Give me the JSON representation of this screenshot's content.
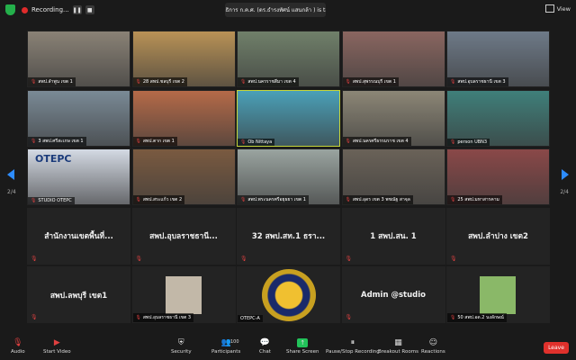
{
  "topbar": {
    "recording_label": "Recording...",
    "pause_glyph": "❚❚",
    "stop_glyph": "■",
    "speaker_text": "ของเลขาธิการ ก.ค.ศ. (ดร.ธำรงทัศน์ แสนกล้า ) is talking...",
    "view_label": "View"
  },
  "pagination": {
    "left": "2/4",
    "right": "2/4"
  },
  "tiles": [
    {
      "name": "สพป.ลำพูน เขต 1",
      "type": "video",
      "bg": "#8a8276"
    },
    {
      "name": "28 สพป.ชลบุรี เขต 2",
      "type": "video",
      "bg": "#b99256"
    },
    {
      "name": "สพป.นครราชสีมา เขต 4",
      "type": "video",
      "bg": "#70806a"
    },
    {
      "name": "สพป.สุพรรณบุรี เขต 1",
      "type": "video",
      "bg": "#8a6660"
    },
    {
      "name": "สพป.อุบลราชธานี เขต 3",
      "type": "video",
      "bg": "#6e7a88"
    },
    {
      "name": "3 สพป.ศรีสะเกษ เขต 1",
      "type": "video",
      "bg": "#7a8a96"
    },
    {
      "name": "สพป.ตาก เขต 1",
      "type": "video",
      "bg": "#b56a48"
    },
    {
      "name": "Ob Nittaya",
      "type": "video",
      "bg": "#4aa0b8",
      "active": true
    },
    {
      "name": "สพป.นครศรีธรรมราช เขต 4",
      "type": "video",
      "bg": "#8c8676"
    },
    {
      "name": "person UBN3",
      "type": "video",
      "bg": "#3f7f7a"
    },
    {
      "name": "STUDIO OTEPC",
      "type": "video",
      "bg": "#d4dae4",
      "overlay": "OTEPC"
    },
    {
      "name": "สพป.สระแก้ว เขต 2",
      "type": "video",
      "bg": "#7a5a40"
    },
    {
      "name": "สพป.พระนครศรีอยุธยา เขต 1",
      "type": "video",
      "bg": "#9aa4a0"
    },
    {
      "name": "สพป.อุดร เขต 3 พชณัฐ สาจุล",
      "type": "video",
      "bg": "#6a6258"
    },
    {
      "name": "25 สพป.มหาสารคาม",
      "type": "video",
      "bg": "#8a4848"
    },
    {
      "name": "สำนักงานเขตพื้นที่...",
      "type": "name"
    },
    {
      "name": "สพป.อุบลราชธานี...",
      "type": "name"
    },
    {
      "name": "32 สพป.สท.1 ธรา...",
      "type": "name"
    },
    {
      "name": "1 สพป.สน. 1",
      "type": "name"
    },
    {
      "name": "สพป.ลำปาง เขต2",
      "type": "name"
    },
    {
      "name": "สพป.ลพบุรี เขต1",
      "type": "name"
    },
    {
      "name": "สพป.อุบลราชธานี เขต 3",
      "type": "photo",
      "bg": "#c2b8a8"
    },
    {
      "name": "OTEPC-A",
      "type": "logo"
    },
    {
      "name": "Admin @studio",
      "type": "name"
    },
    {
      "name": "50 สพป.อด.2 นงลักษณ์",
      "type": "photo",
      "bg": "#8ab868"
    }
  ],
  "toolbar": {
    "audio": "Audio",
    "video": "Start Video",
    "security": "Security",
    "participants": "Participants",
    "participants_count": "100",
    "chat": "Chat",
    "share": "Share Screen",
    "recording": "Pause/Stop Recording",
    "breakout": "Breakout Rooms",
    "reactions": "Reactions",
    "leave": "Leave"
  },
  "colors": {
    "accent": "#2d8cff",
    "share_green": "#22c35a",
    "leave_red": "#e0312c",
    "active_speaker": "#c6d63a"
  }
}
